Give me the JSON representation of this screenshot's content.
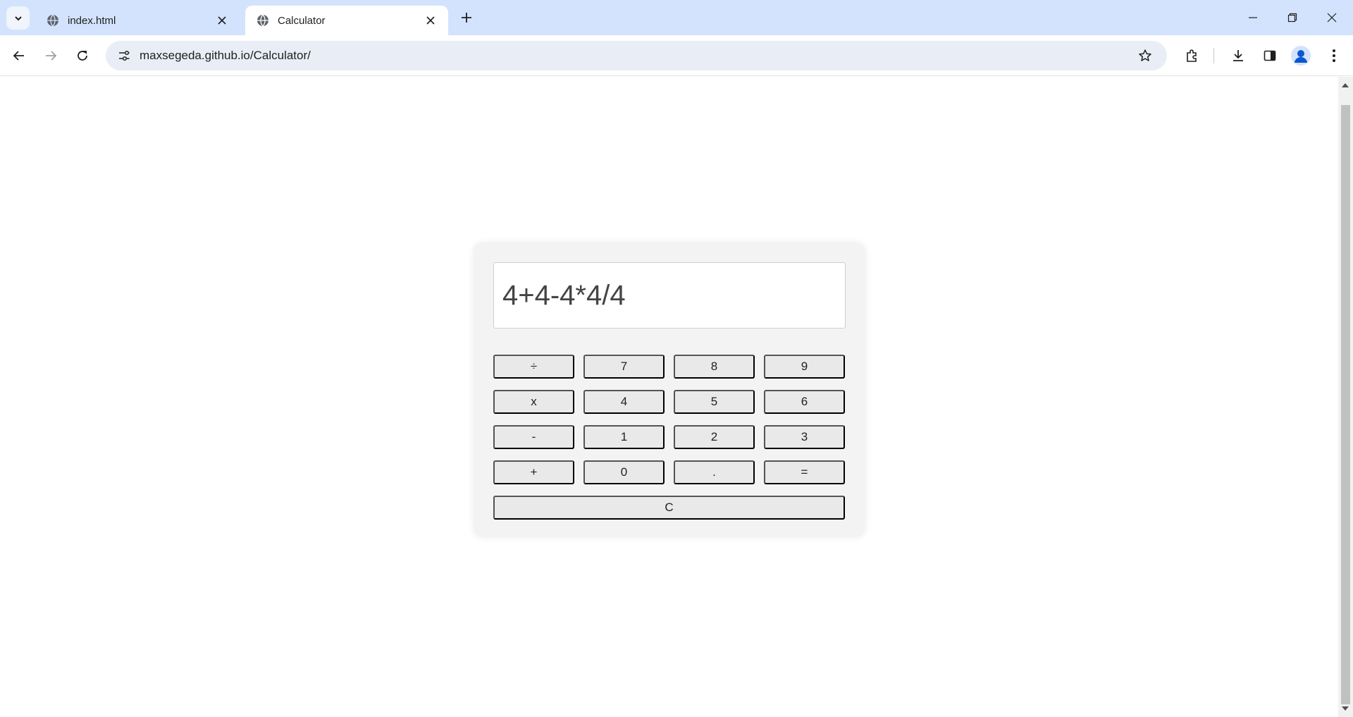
{
  "browser": {
    "tabs": [
      {
        "title": "index.html",
        "active": false
      },
      {
        "title": "Calculator",
        "active": true
      }
    ],
    "url": "maxsegeda.github.io/Calculator/",
    "icons": [
      "tab-search-icon",
      "globe-icon",
      "close-icon",
      "plus-icon",
      "minimize-icon",
      "restore-icon",
      "window-close-icon",
      "back-icon",
      "forward-icon",
      "reload-icon",
      "site-info-icon",
      "star-icon",
      "extensions-icon",
      "download-icon",
      "sidepanel-icon",
      "profile-icon",
      "menu-icon"
    ]
  },
  "calculator": {
    "display": "4+4-4*4/4",
    "keys": [
      "÷",
      "7",
      "8",
      "9",
      "x",
      "4",
      "5",
      "6",
      "-",
      "1",
      "2",
      "3",
      "+",
      "0",
      ".",
      "="
    ],
    "clear_label": "C"
  },
  "colors": {
    "tabstrip": "#d3e3fd",
    "omnibox": "#e9eef6",
    "calculator_bg": "#f3f3f3",
    "key_bg": "#e9e9e9"
  }
}
